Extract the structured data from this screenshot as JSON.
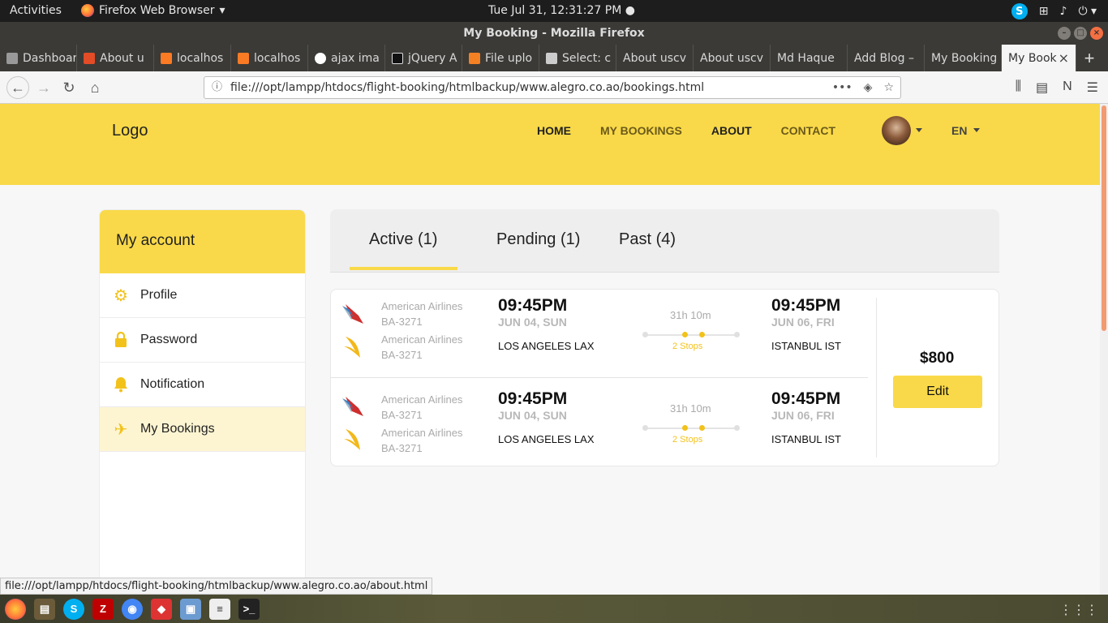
{
  "system": {
    "activities": "Activities",
    "app_menu": "Firefox Web Browser",
    "clock": "Tue Jul 31, 12:31:27 PM"
  },
  "window": {
    "title": "My Booking - Mozilla Firefox"
  },
  "browser_tabs": [
    {
      "label": "Dashboard",
      "icon": "dashboard-favicon"
    },
    {
      "label": "About u",
      "icon": "html-favicon"
    },
    {
      "label": "localhos",
      "icon": "xampp-favicon"
    },
    {
      "label": "localhos",
      "icon": "xampp-favicon"
    },
    {
      "label": "ajax ima",
      "icon": "google-favicon"
    },
    {
      "label": "jQuery A",
      "icon": "pp-favicon"
    },
    {
      "label": "File uplo",
      "icon": "stackoverflow-favicon"
    },
    {
      "label": "Select: c",
      "icon": "settings-favicon"
    },
    {
      "label": "About uscv",
      "icon": "page-favicon"
    },
    {
      "label": "About uscv",
      "icon": "page-favicon"
    },
    {
      "label": "Md Haque",
      "icon": "page-favicon"
    },
    {
      "label": "Add Blog –",
      "icon": "page-favicon"
    },
    {
      "label": "My Booking",
      "icon": "page-favicon"
    },
    {
      "label": "My Book",
      "icon": "page-favicon",
      "active": true
    }
  ],
  "urlbar": {
    "url": "file:///opt/lampp/htdocs/flight-booking/htmlbackup/www.alegro.co.ao/bookings.html"
  },
  "site": {
    "logo": "Logo",
    "menu": {
      "home": "HOME",
      "my_bookings": "MY BOOKINGS",
      "about": "ABOUT",
      "contact": "CONTACT"
    },
    "language": "EN"
  },
  "sidebar": {
    "title": "My account",
    "items": [
      {
        "label": "Profile",
        "icon": "gear-icon"
      },
      {
        "label": "Password",
        "icon": "lock-icon"
      },
      {
        "label": "Notification",
        "icon": "bell-icon"
      },
      {
        "label": "My Bookings",
        "icon": "airplane-icon",
        "current": true
      }
    ]
  },
  "booking_tabs": {
    "active": "Active (1)",
    "pending": "Pending (1)",
    "past": "Past (4)"
  },
  "booking": {
    "price": "$800",
    "edit_label": "Edit",
    "legs": [
      {
        "airlines": [
          {
            "name": "American Airlines",
            "flight": "BA-3271",
            "logo": "american-airlines-logo"
          },
          {
            "name": "American Airlines",
            "flight": "BA-3271",
            "logo": "singapore-airlines-logo"
          }
        ],
        "depart_time": "09:45PM",
        "depart_date": "JUN 04, SUN",
        "depart_city": "LOS ANGELES LAX",
        "duration": "31h 10m",
        "stops": "2 Stops",
        "arrive_time": "09:45PM",
        "arrive_date": "JUN 06, FRI",
        "arrive_city": "ISTANBUL IST"
      },
      {
        "airlines": [
          {
            "name": "American Airlines",
            "flight": "BA-3271",
            "logo": "american-airlines-logo"
          },
          {
            "name": "American Airlines",
            "flight": "BA-3271",
            "logo": "singapore-airlines-logo"
          }
        ],
        "depart_time": "09:45PM",
        "depart_date": "JUN 04, SUN",
        "depart_city": "LOS ANGELES LAX",
        "duration": "31h 10m",
        "stops": "2 Stops",
        "arrive_time": "09:45PM",
        "arrive_date": "JUN 06, FRI",
        "arrive_city": "ISTANBUL IST"
      }
    ]
  },
  "status_bar": {
    "link": "file:///opt/lampp/htdocs/flight-booking/htmlbackup/www.alegro.co.ao/about.html"
  },
  "colors": {
    "brand_yellow": "#f9d949",
    "accent_gold": "#f2c21b",
    "selected_row": "#fdf5d2"
  }
}
